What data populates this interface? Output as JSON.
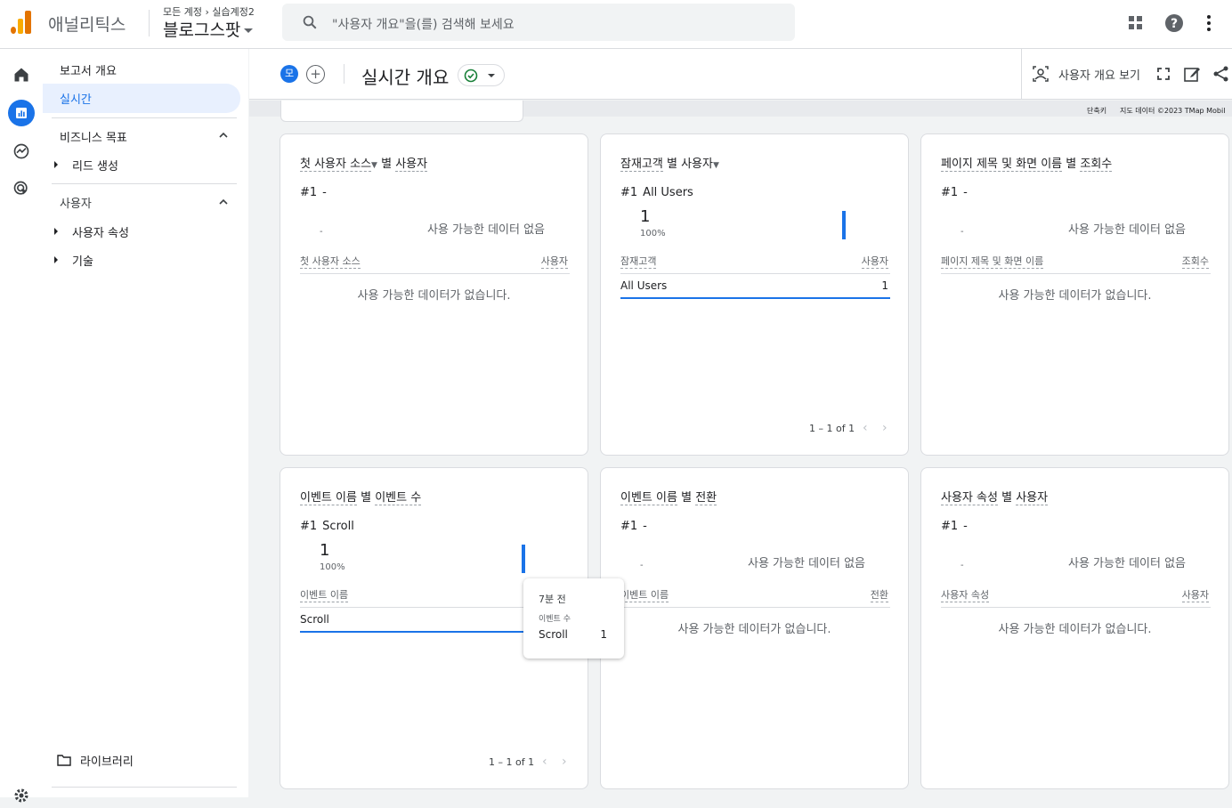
{
  "app": {
    "name": "애널리틱스",
    "breadcrumb_all": "모든 계정",
    "breadcrumb_account": "실습계정2",
    "property": "블로그스팟"
  },
  "search": {
    "placeholder": "\"사용자 개요\"을(를) 검색해 보세요"
  },
  "sidenav": {
    "overview": "보고서 개요",
    "realtime": "실시간",
    "section1": "비즈니스 목표",
    "lead": "리드 생성",
    "section2": "사용자",
    "user_attr": "사용자 속성",
    "tech": "기술",
    "library": "라이브러리"
  },
  "header": {
    "avatar": "모",
    "title": "실시간 개요",
    "view_user_overview": "사용자 개요 보기"
  },
  "map": {
    "shortcut": "단축키",
    "credit": "지도 데이터 ©2023 TMap Mobil"
  },
  "cards": [
    {
      "title": "첫 사용자 소스▾ 별 사용자",
      "title_a": "첫 사용자 소스",
      "title_b": "별",
      "title_c": "사용자",
      "rank": "#1",
      "rank_value": "-",
      "dash": "-",
      "no_data": "사용 가능한 데이터 없음",
      "col1": "첫 사용자 소스",
      "col2": "사용자",
      "table_empty": "사용 가능한 데이터가 없습니다."
    },
    {
      "title_a": "잠재고객",
      "title_b": "별 사용자",
      "rank": "#1",
      "rank_value": "All Users",
      "big": "1",
      "pct": "100%",
      "col1": "잠재고객",
      "col2": "사용자",
      "row_label": "All Users",
      "row_value": "1",
      "pager": "1 – 1 of 1"
    },
    {
      "title_a": "페이지 제목 및 화면 이름",
      "title_b": "별",
      "title_c": "조회수",
      "rank": "#1",
      "rank_value": "-",
      "dash": "-",
      "no_data": "사용 가능한 데이터 없음",
      "col1": "페이지 제목 및 화면 이름",
      "col2": "조회수",
      "table_empty": "사용 가능한 데이터가 없습니다."
    },
    {
      "title_a": "이벤트 이름",
      "title_b": "별",
      "title_c": "이벤트 수",
      "rank": "#1",
      "rank_value": "Scroll",
      "big": "1",
      "pct": "100%",
      "col1": "이벤트 이름",
      "row_label": "Scroll",
      "pager": "1 – 1 of 1"
    },
    {
      "title_a": "이벤트 이름",
      "title_b": "별",
      "title_c": "전환",
      "rank": "#1",
      "rank_value": "-",
      "dash": "-",
      "no_data": "사용 가능한 데이터 없음",
      "col1": "이벤트 이름",
      "col2": "전환",
      "table_empty": "사용 가능한 데이터가 없습니다."
    },
    {
      "title_a": "사용자 속성",
      "title_b": "별",
      "title_c": "사용자",
      "rank": "#1",
      "rank_value": "-",
      "dash": "-",
      "no_data": "사용 가능한 데이터 없음",
      "col1": "사용자 속성",
      "col2": "사용자",
      "table_empty": "사용 가능한 데이터가 없습니다."
    }
  ],
  "tooltip": {
    "time": "7분 전",
    "metric": "이벤트 수",
    "label": "Scroll",
    "value": "1"
  },
  "colors": {
    "accent": "#1a73e8",
    "logo_orange": "#f9ab00",
    "logo_dark": "#e37400",
    "success": "#188038"
  }
}
